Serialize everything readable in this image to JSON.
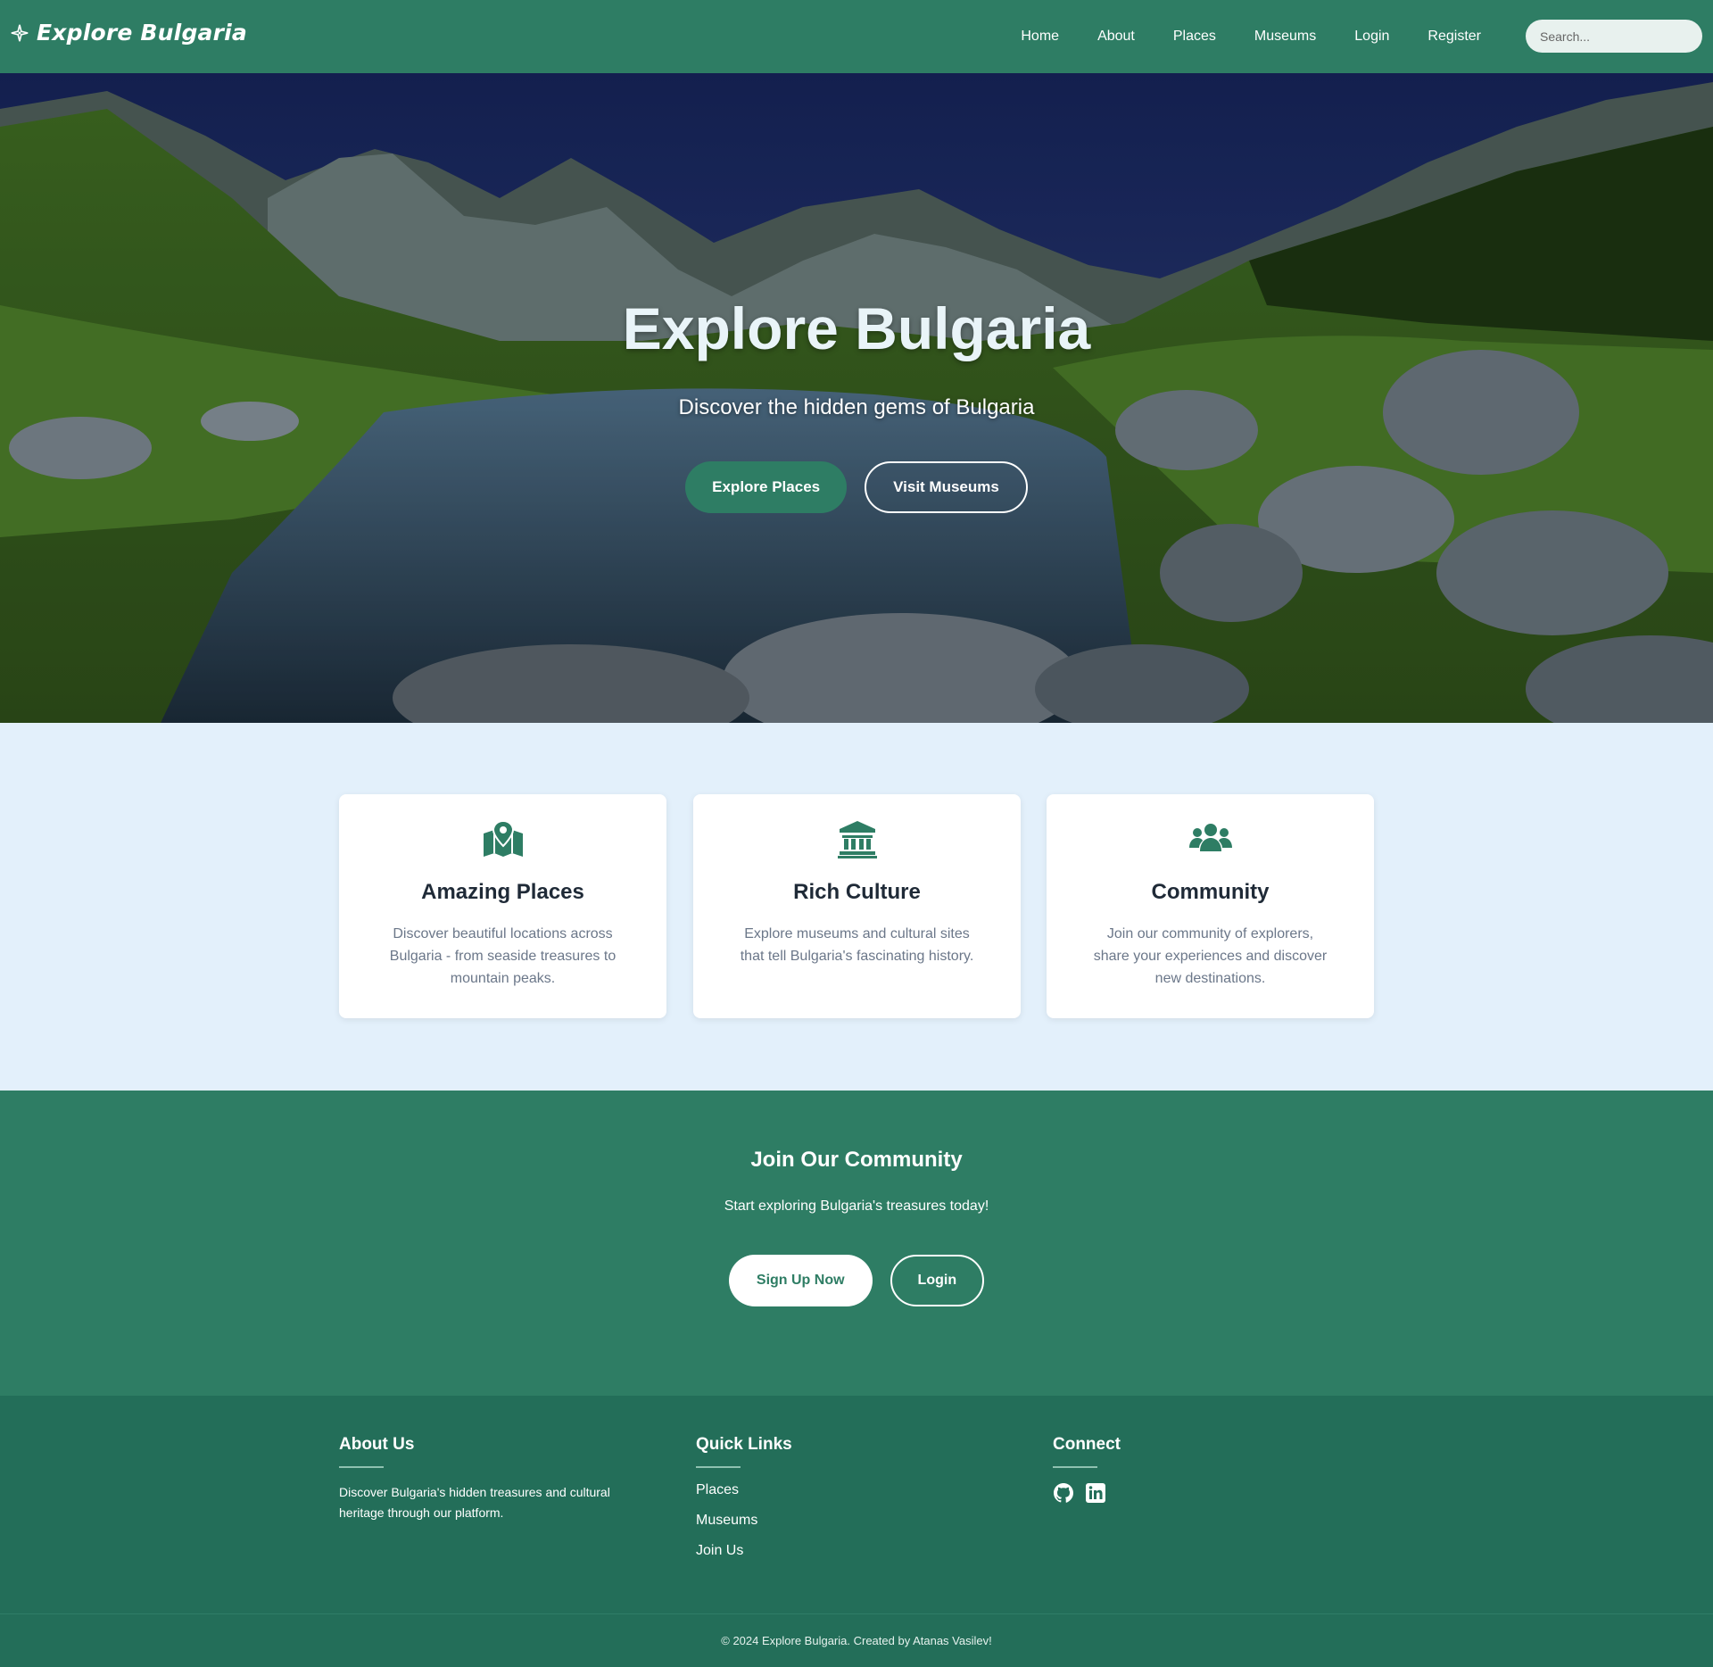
{
  "brand": {
    "name": "Explore Bulgaria",
    "icon": "compass-star-icon"
  },
  "nav": {
    "items": [
      "Home",
      "About",
      "Places",
      "Museums",
      "Login",
      "Register"
    ],
    "search_placeholder": "Search..."
  },
  "hero": {
    "title": "Explore Bulgaria",
    "subtitle": "Discover the hidden gems of Bulgaria",
    "primary_button": "Explore Places",
    "secondary_button": "Visit Museums"
  },
  "features": [
    {
      "icon": "map-location-icon",
      "title": "Amazing Places",
      "text": "Discover beautiful locations across Bulgaria - from seaside treasures to mountain peaks."
    },
    {
      "icon": "landmark-icon",
      "title": "Rich Culture",
      "text": "Explore museums and cultural sites that tell Bulgaria's fascinating history."
    },
    {
      "icon": "users-icon",
      "title": "Community",
      "text": "Join our community of explorers, share your experiences and discover new destinations."
    }
  ],
  "cta": {
    "title": "Join Our Community",
    "text": "Start exploring Bulgaria's treasures today!",
    "primary_button": "Sign Up Now",
    "secondary_button": "Login"
  },
  "footer": {
    "about": {
      "title": "About Us",
      "text": "Discover Bulgaria's hidden treasures and cultural heritage through our platform."
    },
    "quick_links": {
      "title": "Quick Links",
      "items": [
        "Places",
        "Museums",
        "Join Us"
      ]
    },
    "connect": {
      "title": "Connect",
      "icons": [
        "github-icon",
        "linkedin-icon"
      ]
    },
    "copyright": "© 2024 Explore Bulgaria. Created by Atanas Vasilev!"
  },
  "colors": {
    "primary": "#2e7d64",
    "footer": "#236e59",
    "section_bg": "#e3f0fb"
  }
}
